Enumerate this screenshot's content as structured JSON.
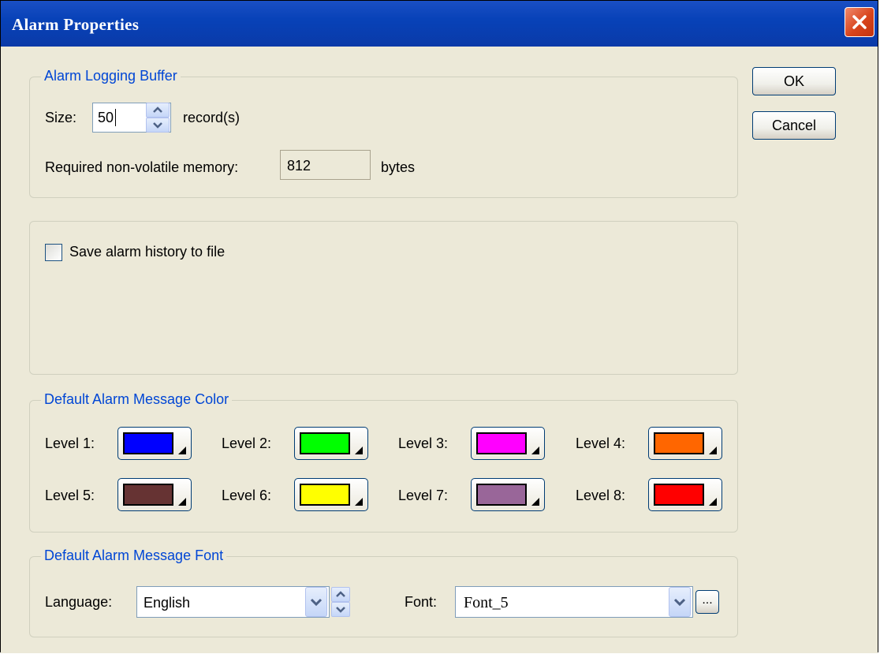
{
  "dialog": {
    "title": "Alarm Properties"
  },
  "buttons": {
    "ok": "OK",
    "cancel": "Cancel"
  },
  "logging": {
    "legend": "Alarm Logging Buffer",
    "size_label": "Size:",
    "size_value": "50",
    "size_unit": "record(s)",
    "memory_label": "Required non-volatile memory:",
    "memory_value": "812",
    "memory_unit": "bytes"
  },
  "history": {
    "checkbox_label": "Save alarm history to file",
    "checked": false
  },
  "color": {
    "legend": "Default Alarm Message Color",
    "levels": [
      {
        "label": "Level 1:",
        "color": "#0000ff"
      },
      {
        "label": "Level 2:",
        "color": "#00ff00"
      },
      {
        "label": "Level 3:",
        "color": "#ff00ff"
      },
      {
        "label": "Level 4:",
        "color": "#ff6600"
      },
      {
        "label": "Level 5:",
        "color": "#663333"
      },
      {
        "label": "Level 6:",
        "color": "#ffff00"
      },
      {
        "label": "Level 7:",
        "color": "#996699"
      },
      {
        "label": "Level 8:",
        "color": "#ff0000"
      }
    ]
  },
  "font": {
    "legend": "Default Alarm Message Font",
    "language_label": "Language:",
    "language_value": "English",
    "font_label": "Font:",
    "font_value": "Font_5",
    "browse_label": "..."
  },
  "icons": {
    "close": "close-icon",
    "spin": "spin-up-down-icon",
    "dropdown": "chevron-down-icon"
  },
  "colors": {
    "title_bar": "#0842b8",
    "dialog_bg": "#ece9d8",
    "legend_text": "#0046d5"
  }
}
